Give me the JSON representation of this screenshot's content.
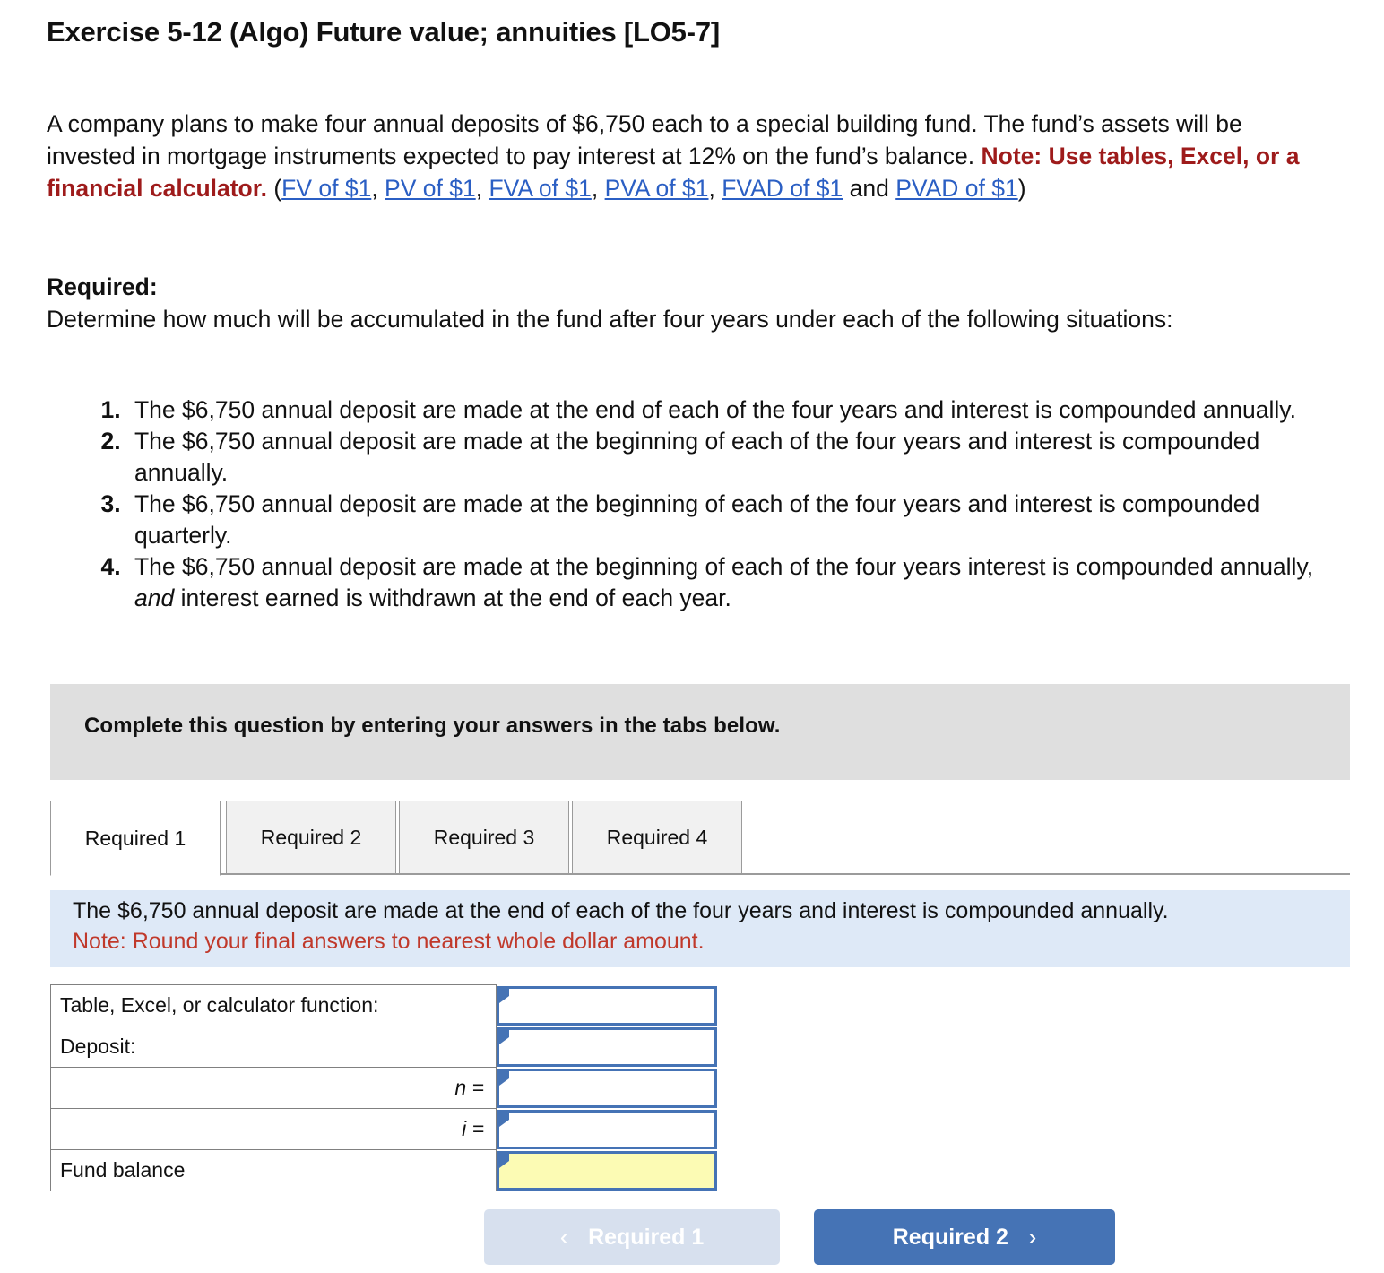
{
  "title": "Exercise 5-12 (Algo) Future value; annuities [LO5-7]",
  "intro": {
    "sentence1": "A company plans to make four annual deposits of $6,750 each to a special building fund. The fund’s assets will be invested in mortgage instruments expected to pay interest at 12% on the fund’s balance.",
    "note_label": "Note: Use tables, Excel, or a financial calculator.",
    "open_paren": " (",
    "links": [
      {
        "label": "FV of $1",
        "sep": ", "
      },
      {
        "label": "PV of $1",
        "sep": ", "
      },
      {
        "label": "FVA of $1",
        "sep": ", "
      },
      {
        "label": "PVA of $1",
        "sep": ", "
      },
      {
        "label": "FVAD of $1",
        "sep": " and "
      },
      {
        "label": "PVAD of $1",
        "sep": ")"
      }
    ]
  },
  "required": {
    "heading": "Required:",
    "body": "Determine how much will be accumulated in the fund after four years under each of the following situations:",
    "situations": [
      "The $6,750 annual deposit are made at the end of each of the four years and interest is compounded annually.",
      "The $6,750 annual deposit are made at the beginning of each of the four years and interest is compounded annually.",
      "The $6,750 annual deposit are made at the beginning of each of the four years and interest is compounded quarterly.",
      "The $6,750 annual deposit are made at the beginning of each of the four years interest is compounded annually, and interest earned is withdrawn at the end of each year."
    ],
    "situation4_pre": "The $6,750 annual deposit are made at the beginning of each of the four years interest is compounded annually, ",
    "situation4_italic": "and",
    "situation4_post": " interest earned is withdrawn at the end of each year."
  },
  "instruction_bar": {
    "text": "Complete this question by entering your answers in the tabs below."
  },
  "tabs": [
    {
      "label": "Required 1",
      "active": true
    },
    {
      "label": "Required 2",
      "active": false
    },
    {
      "label": "Required 3",
      "active": false
    },
    {
      "label": "Required 4",
      "active": false
    }
  ],
  "banner": {
    "line1": "The $6,750 annual deposit are made at the end of each of the four years and interest is compounded annually.",
    "line2": "Note: Round your final answers to nearest whole dollar amount."
  },
  "answer_table": {
    "rows": [
      {
        "label": "Table, Excel, or calculator function:",
        "align": "left",
        "value": "",
        "highlight": false
      },
      {
        "label": "Deposit:",
        "align": "left",
        "value": "",
        "highlight": false
      },
      {
        "label": "n =",
        "align": "right",
        "value": "",
        "highlight": false
      },
      {
        "label": "i =",
        "align": "right",
        "value": "",
        "highlight": false
      },
      {
        "label": "Fund balance",
        "align": "left",
        "value": "",
        "highlight": true
      }
    ]
  },
  "footer": {
    "prev_label": "Required 1",
    "prev_chevron": "‹",
    "next_label": "Required 2",
    "next_chevron": "›"
  },
  "colors": {
    "accent_blue": "#4573b5",
    "disabled_blue": "#d7e0ee",
    "banner_blue": "#dee9f7",
    "grey_bar": "#dfdfdf",
    "highlight_yellow": "#fcfbb4",
    "note_red": "#9e1b1b",
    "warning_red": "#c0392b",
    "link_blue": "#2b5fc4"
  }
}
